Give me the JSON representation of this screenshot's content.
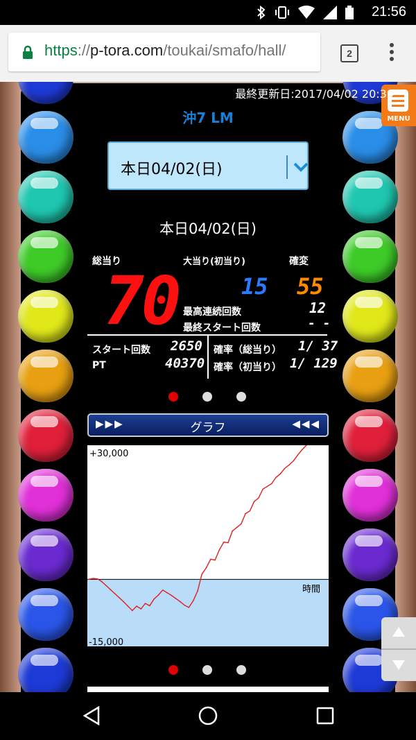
{
  "status_bar": {
    "time": "21:56"
  },
  "browser": {
    "url_scheme": "https",
    "url_sep": "://",
    "url_host": "p-tora.com",
    "url_path": "/toukai/smafo/hall/",
    "tab_count": "2"
  },
  "page": {
    "last_updated": "最終更新日:2017/04/02 20:39",
    "menu_label": "MENU",
    "machine_name": "沖7 LM",
    "date_select_value": "本日04/02(日)",
    "date_title": "本日04/02(日)",
    "stats": {
      "total_hits_label": "総当り",
      "total_hits_value": "70",
      "big_hits_label": "大当り(初当り)",
      "big_hits_value": "15",
      "kakuhen_label": "確変",
      "kakuhen_value": "55",
      "max_streak_label": "最高連続回数",
      "max_streak_value": "12",
      "last_start_label": "最終スタート回数",
      "last_start_value": "- -",
      "start_count_label": "スタート回数",
      "start_count_value": "2650",
      "pt_label": "PT",
      "pt_value": "40370",
      "prob_total_label": "確率（総当り）",
      "prob_total_value": "1/ 37",
      "prob_first_label": "確率（初当り）",
      "prob_first_value": "1/ 129"
    },
    "carousel": {
      "dot_count": 3,
      "active_index": 0,
      "active_color": "#e00000",
      "inactive_color": "#dddddd"
    },
    "graph_header": {
      "title": "グラフ",
      "left_arrows": "▶▶▶",
      "right_arrows": "◀◀◀"
    }
  },
  "chart_data": {
    "type": "line",
    "title": "",
    "ylabel": "",
    "xlabel": "時間",
    "y_top_label": "+30,000",
    "y_bottom_label": "-15,000",
    "ylim": [
      -15000,
      30000
    ],
    "line_color": "#e02020",
    "positive_area_color": "#ffffff",
    "negative_area_color": "#b9dcf8",
    "x": [
      0,
      2,
      4,
      6,
      8,
      10,
      12,
      14,
      16,
      18,
      20,
      22,
      24,
      26,
      28,
      30,
      32,
      34,
      36,
      38,
      40,
      42,
      44,
      46,
      48,
      50,
      52,
      54,
      56,
      58,
      60,
      62,
      64,
      66,
      68,
      70,
      72,
      74,
      76,
      78,
      80,
      82,
      84,
      86,
      88,
      90,
      92,
      94,
      96,
      98,
      100
    ],
    "y": [
      0,
      200,
      100,
      -500,
      -1400,
      -2300,
      -3200,
      -4100,
      -5000,
      -6000,
      -7000,
      -6000,
      -6600,
      -5400,
      -5900,
      -4400,
      -3500,
      -2400,
      -3000,
      -3600,
      -4300,
      -5000,
      -5800,
      -6300,
      -4800,
      -2600,
      1200,
      2600,
      4500,
      4300,
      6600,
      8300,
      8200,
      10800,
      11600,
      12400,
      14700,
      15300,
      17400,
      18200,
      20200,
      20800,
      21400,
      22800,
      23600,
      24800,
      25600,
      26500,
      27800,
      29000,
      30000
    ]
  }
}
